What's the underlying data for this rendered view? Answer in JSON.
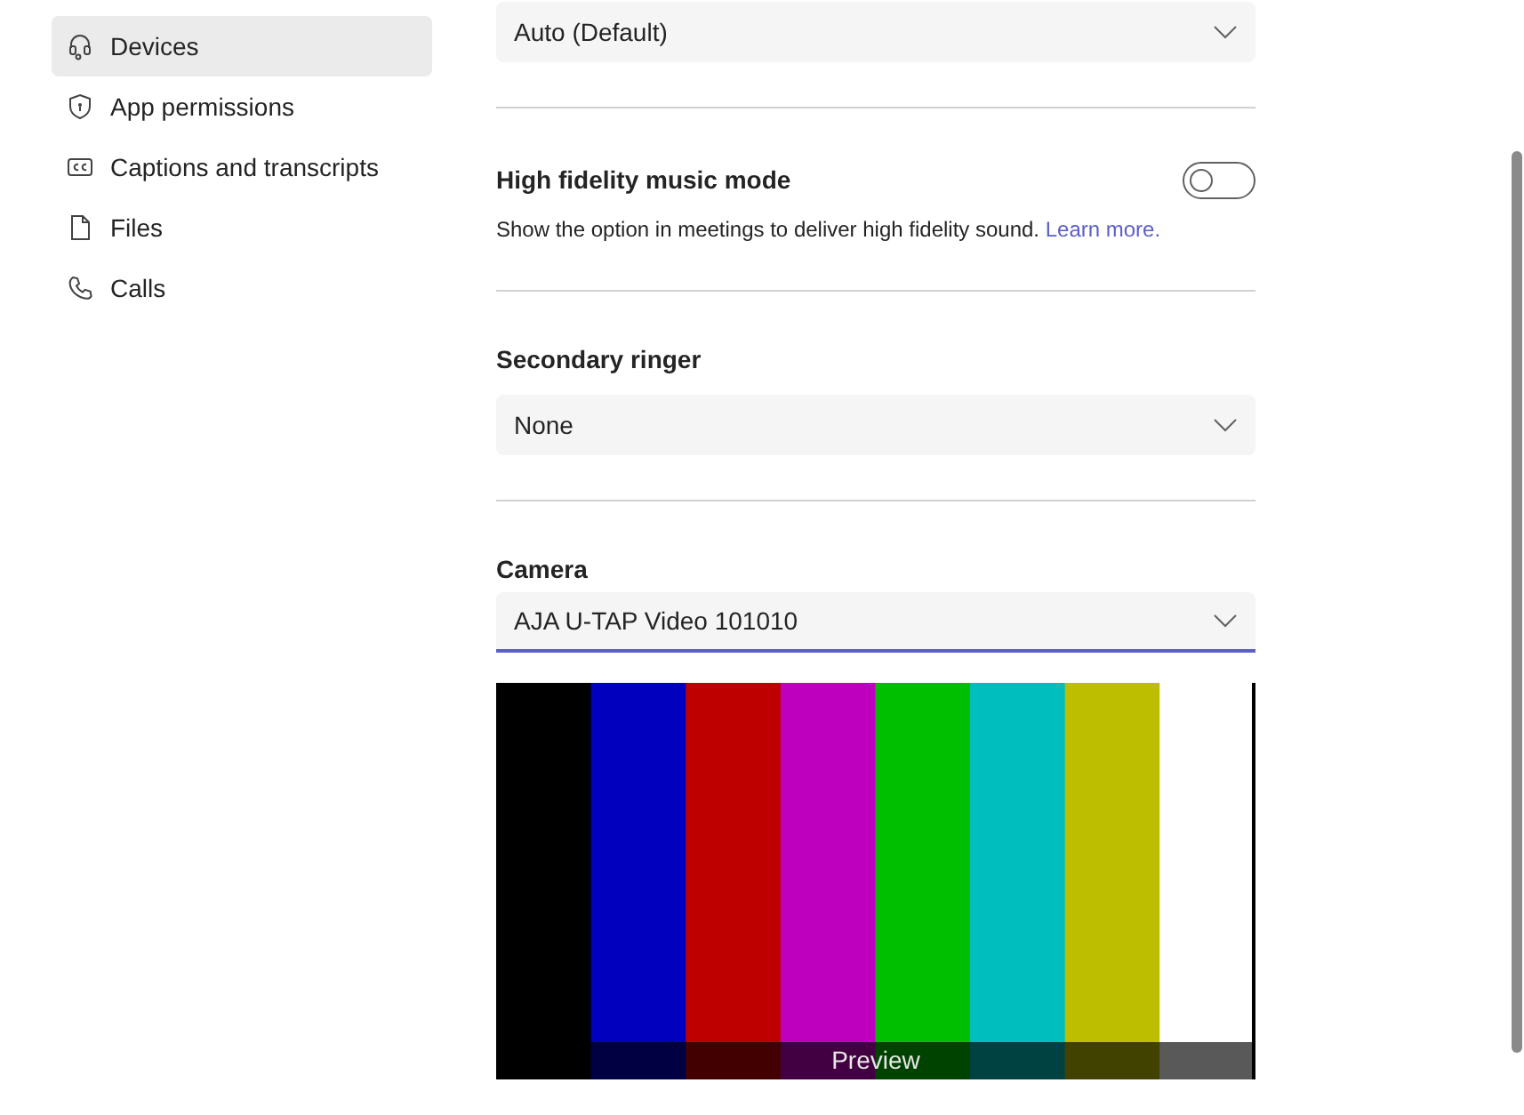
{
  "sidebar": {
    "items": [
      {
        "label": "Devices",
        "selected": true
      },
      {
        "label": "App permissions",
        "selected": false
      },
      {
        "label": "Captions and transcripts",
        "selected": false
      },
      {
        "label": "Files",
        "selected": false
      },
      {
        "label": "Calls",
        "selected": false
      }
    ]
  },
  "sections": [
    {
      "kind": "dropdown",
      "value": "Auto (Default)",
      "focused": false
    },
    {
      "kind": "toggle",
      "title": "High fidelity music mode",
      "on": false,
      "description": "Show the option in meetings to deliver high fidelity sound.",
      "link": "Learn more."
    },
    {
      "kind": "dropdown",
      "title": "Secondary ringer",
      "value": "None",
      "focused": false
    },
    {
      "kind": "camera",
      "title": "Camera",
      "value": "AJA U-TAP Video 101010",
      "focused": true,
      "preview_label": "Preview"
    }
  ]
}
